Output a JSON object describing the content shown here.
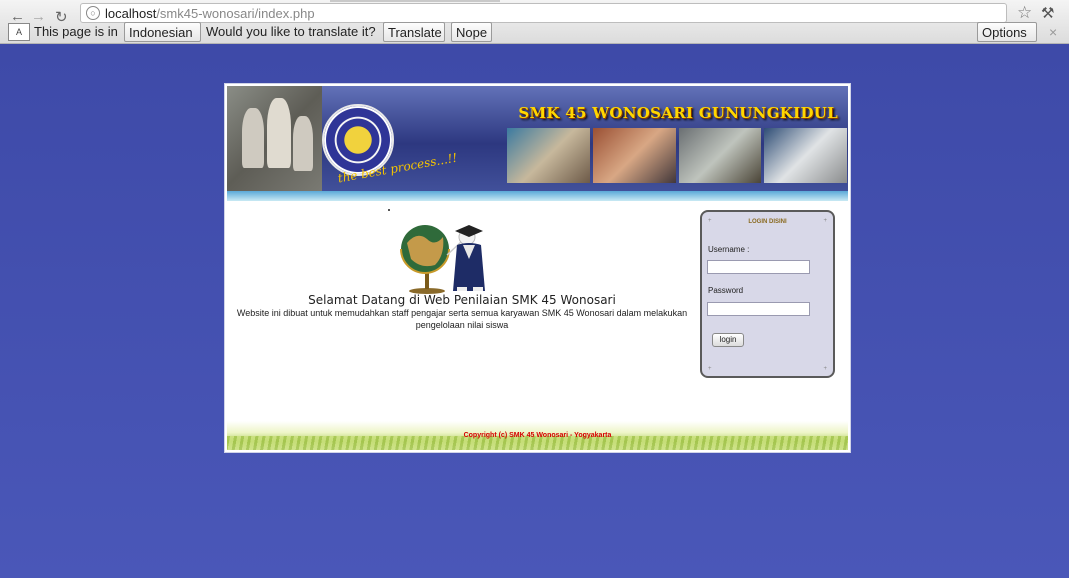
{
  "browser": {
    "url_host": "localhost",
    "url_path": "/smk45-wonosari/index.php"
  },
  "translate_bar": {
    "prefix": "This page is in",
    "language": "Indonesian",
    "question": "Would you like to translate it?",
    "translate_label": "Translate",
    "nope_label": "Nope",
    "options_label": "Options"
  },
  "header": {
    "title": "SMK 45 WONOSARI GUNUNGKIDUL",
    "slogan": "the best process...!!"
  },
  "main": {
    "welcome": "Selamat Datang di Web Penilaian SMK 45 Wonosari",
    "description": "Website ini dibuat untuk memudahkan staff pengajar serta semua karyawan SMK 45 Wonosari dalam melakukan pengelolaan nilai siswa"
  },
  "login": {
    "title": "LOGIN DISINI",
    "username_label": "Username :",
    "password_label": "Password",
    "button_label": "login"
  },
  "footer": {
    "copyright": "Copyright (c) SMK 45 Wonosari - Yogyakarta"
  },
  "colors": {
    "page_background": "#4350ad",
    "header_title": "#ffd700",
    "footer_text": "#d60000"
  }
}
